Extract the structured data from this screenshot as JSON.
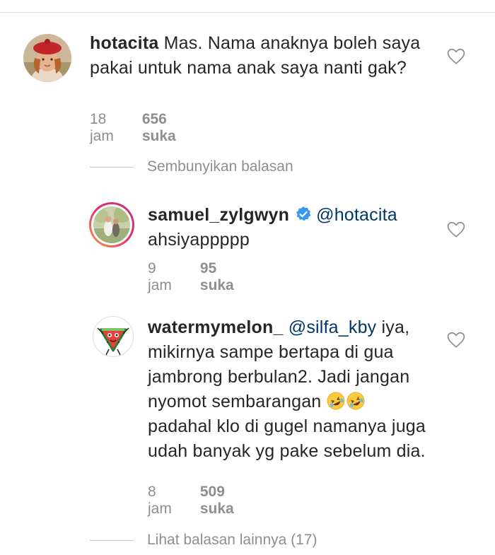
{
  "comments": [
    {
      "username": "hotacita",
      "text": "Mas. Nama anaknya boleh saya pakai untuk nama anak saya nanti gak?",
      "time": "18 jam",
      "likes": "656 suka"
    }
  ],
  "hide_replies_label": "Sembunyikan balasan",
  "replies": [
    {
      "username": "samuel_zylgwyn",
      "verified": true,
      "mention": "@hotacita",
      "text": "ahsiyappppp",
      "time": "9 jam",
      "likes": "95 suka"
    },
    {
      "username": "watermymelon_",
      "mention": "@silfa_kby",
      "text_1": "iya, mikirnya sampe bertapa di gua jambrong berbulan2. Jadi jangan nyomot sembarangan",
      "emoji": "rolling-on-floor-laughing-emoji",
      "text_2": "padahal klo di gugel namanya juga udah banyak yg pake sebelum dia.",
      "time": "8 jam",
      "likes": "509 suka"
    }
  ],
  "view_more_replies_label": "Lihat balasan lainnya (17)",
  "colors": {
    "text": "#262626",
    "secondary": "#8e8e8e",
    "mention": "#00376b",
    "verified": "#3897f0",
    "story_ring_start": "#f9a03f",
    "story_ring_end": "#c13584"
  }
}
